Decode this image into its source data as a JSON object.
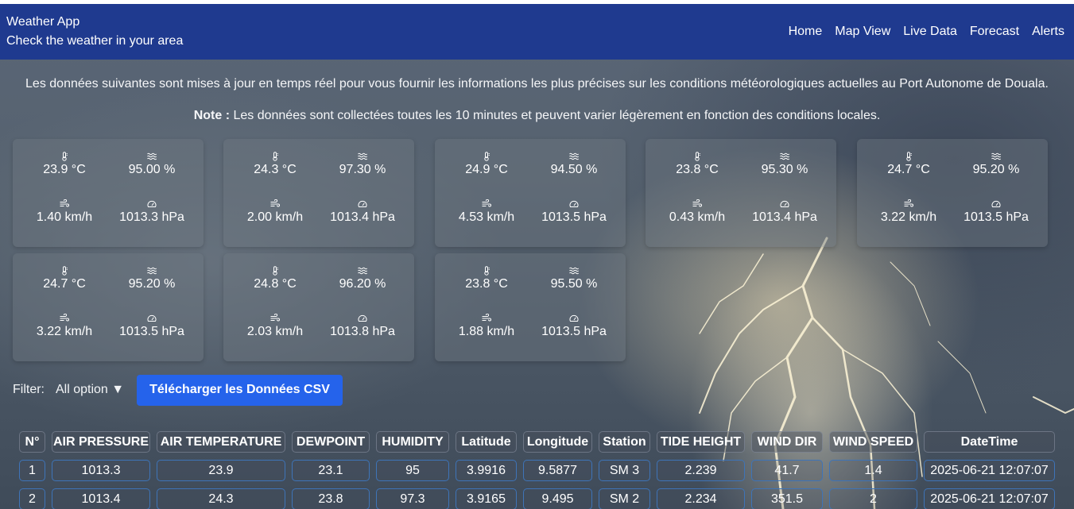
{
  "header": {
    "title": "Weather App",
    "subtitle": "Check the weather in your area",
    "nav": [
      "Home",
      "Map View",
      "Live Data",
      "Forecast",
      "Alerts"
    ]
  },
  "intro": "Les données suivantes sont mises à jour en temps réel pour vous fournir les informations les plus précises sur les conditions météorologiques actuelles au Port Autonome de Douala.",
  "note": {
    "label": "Note :",
    "text": " Les données sont collectées toutes les 10 minutes et peuvent varier légèrement en fonction des conditions locales."
  },
  "cards": [
    {
      "temperature": "23.9 °C",
      "humidity": "95.00 %",
      "wind": "1.40 km/h",
      "pressure": "1013.3 hPa"
    },
    {
      "temperature": "24.3 °C",
      "humidity": "97.30 %",
      "wind": "2.00 km/h",
      "pressure": "1013.4 hPa"
    },
    {
      "temperature": "24.9 °C",
      "humidity": "94.50 %",
      "wind": "4.53 km/h",
      "pressure": "1013.5 hPa"
    },
    {
      "temperature": "23.8 °C",
      "humidity": "95.30 %",
      "wind": "0.43 km/h",
      "pressure": "1013.4 hPa"
    },
    {
      "temperature": "24.7 °C",
      "humidity": "95.20 %",
      "wind": "3.22 km/h",
      "pressure": "1013.5 hPa"
    },
    {
      "temperature": "24.7 °C",
      "humidity": "95.20 %",
      "wind": "3.22 km/h",
      "pressure": "1013.5 hPa"
    },
    {
      "temperature": "24.8 °C",
      "humidity": "96.20 %",
      "wind": "2.03 km/h",
      "pressure": "1013.8 hPa"
    },
    {
      "temperature": "23.8 °C",
      "humidity": "95.50 %",
      "wind": "1.88 km/h",
      "pressure": "1013.5 hPa"
    }
  ],
  "icons": {
    "temperature": "thermometer-icon",
    "humidity": "waves-icon",
    "wind": "wind-icon",
    "pressure": "gauge-icon"
  },
  "filter": {
    "label": "Filter:",
    "selected": "All option",
    "caret": "▼"
  },
  "download_button": "Télécharger les Données CSV",
  "table": {
    "headers": [
      "N°",
      "AIR PRESSURE",
      "AIR TEMPERATURE",
      "DEWPOINT",
      "HUMIDITY",
      "Latitude",
      "Longitude",
      "Station",
      "TIDE HEIGHT",
      "WIND DIR",
      "WIND SPEED",
      "DateTime"
    ],
    "rows": [
      [
        "1",
        "1013.3",
        "23.9",
        "23.1",
        "95",
        "3.9916",
        "9.5877",
        "SM 3",
        "2.239",
        "41.7",
        "1.4",
        "2025-06-21 12:07:07"
      ],
      [
        "2",
        "1013.4",
        "24.3",
        "23.8",
        "97.3",
        "3.9165",
        "9.495",
        "SM 2",
        "2.234",
        "351.5",
        "2",
        "2025-06-21 12:07:07"
      ]
    ]
  }
}
